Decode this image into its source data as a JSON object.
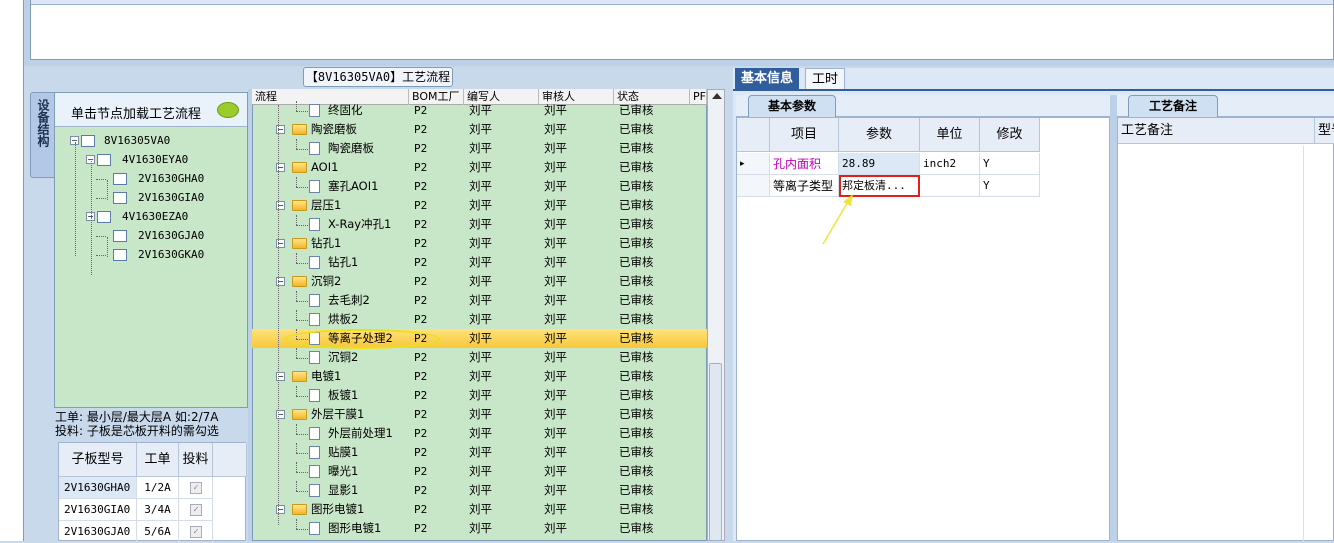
{
  "left_tab": "设备结构",
  "tree_panel": {
    "title": "单击节点加载工艺流程",
    "nodes": [
      {
        "label": "8V16305VA0",
        "level": 0
      },
      {
        "label": "4V1630EYA0",
        "level": 1
      },
      {
        "label": "2V1630GHA0",
        "level": 2
      },
      {
        "label": "2V1630GIA0",
        "level": 2
      },
      {
        "label": "4V1630EZA0",
        "level": 1
      },
      {
        "label": "2V1630GJA0",
        "level": 2
      },
      {
        "label": "2V1630GKA0",
        "level": 2
      }
    ],
    "info_line1": "工单: 最小层/最大层A 如:2/7A",
    "info_line2": "投料: 子板是芯板开料的需勾选"
  },
  "sub_grid": {
    "headers": [
      "子板型号",
      "工单",
      "投料"
    ],
    "rows": [
      {
        "model": "2V1630GHA0",
        "order": "1/2A"
      },
      {
        "model": "2V1630GIA0",
        "order": "3/4A"
      },
      {
        "model": "2V1630GJA0",
        "order": "5/6A"
      }
    ]
  },
  "process": {
    "tab_title": "【8V16305VA0】工艺流程",
    "headers": [
      "流程",
      "BOM工厂",
      "编写人",
      "审核人",
      "状态",
      "PF"
    ],
    "rows": [
      {
        "name": "终固化",
        "type": "doc",
        "factory": "P2",
        "writer": "刘平",
        "reviewer": "刘平",
        "status": "已审核"
      },
      {
        "name": "陶瓷磨板",
        "type": "folder",
        "factory": "P2",
        "writer": "刘平",
        "reviewer": "刘平",
        "status": "已审核"
      },
      {
        "name": "陶瓷磨板",
        "type": "doc",
        "factory": "P2",
        "writer": "刘平",
        "reviewer": "刘平",
        "status": "已审核"
      },
      {
        "name": "AOI1",
        "type": "folder",
        "factory": "P2",
        "writer": "刘平",
        "reviewer": "刘平",
        "status": "已审核"
      },
      {
        "name": "塞孔AOI1",
        "type": "doc",
        "factory": "P2",
        "writer": "刘平",
        "reviewer": "刘平",
        "status": "已审核"
      },
      {
        "name": "层压1",
        "type": "folder",
        "factory": "P2",
        "writer": "刘平",
        "reviewer": "刘平",
        "status": "已审核"
      },
      {
        "name": "X-Ray冲孔1",
        "type": "doc",
        "factory": "P2",
        "writer": "刘平",
        "reviewer": "刘平",
        "status": "已审核"
      },
      {
        "name": "钻孔1",
        "type": "folder",
        "factory": "P2",
        "writer": "刘平",
        "reviewer": "刘平",
        "status": "已审核"
      },
      {
        "name": "钻孔1",
        "type": "doc",
        "factory": "P2",
        "writer": "刘平",
        "reviewer": "刘平",
        "status": "已审核"
      },
      {
        "name": "沉铜2",
        "type": "folder",
        "factory": "P2",
        "writer": "刘平",
        "reviewer": "刘平",
        "status": "已审核"
      },
      {
        "name": "去毛刺2",
        "type": "doc",
        "factory": "P2",
        "writer": "刘平",
        "reviewer": "刘平",
        "status": "已审核"
      },
      {
        "name": "烘板2",
        "type": "doc",
        "factory": "P2",
        "writer": "刘平",
        "reviewer": "刘平",
        "status": "已审核"
      },
      {
        "name": "等离子处理2",
        "type": "doc",
        "factory": "P2",
        "writer": "刘平",
        "reviewer": "刘平",
        "status": "已审核",
        "selected": true
      },
      {
        "name": "沉铜2",
        "type": "doc",
        "factory": "P2",
        "writer": "刘平",
        "reviewer": "刘平",
        "status": "已审核"
      },
      {
        "name": "电镀1",
        "type": "folder",
        "factory": "P2",
        "writer": "刘平",
        "reviewer": "刘平",
        "status": "已审核"
      },
      {
        "name": "板镀1",
        "type": "doc",
        "factory": "P2",
        "writer": "刘平",
        "reviewer": "刘平",
        "status": "已审核"
      },
      {
        "name": "外层干膜1",
        "type": "folder",
        "factory": "P2",
        "writer": "刘平",
        "reviewer": "刘平",
        "status": "已审核"
      },
      {
        "name": "外层前处理1",
        "type": "doc",
        "factory": "P2",
        "writer": "刘平",
        "reviewer": "刘平",
        "status": "已审核"
      },
      {
        "name": "贴膜1",
        "type": "doc",
        "factory": "P2",
        "writer": "刘平",
        "reviewer": "刘平",
        "status": "已审核"
      },
      {
        "name": "曝光1",
        "type": "doc",
        "factory": "P2",
        "writer": "刘平",
        "reviewer": "刘平",
        "status": "已审核"
      },
      {
        "name": "显影1",
        "type": "doc",
        "factory": "P2",
        "writer": "刘平",
        "reviewer": "刘平",
        "status": "已审核"
      },
      {
        "name": "图形电镀1",
        "type": "folder",
        "factory": "P2",
        "writer": "刘平",
        "reviewer": "刘平",
        "status": "已审核"
      },
      {
        "name": "图形电镀1",
        "type": "doc",
        "factory": "P2",
        "writer": "刘平",
        "reviewer": "刘平",
        "status": "已审核"
      }
    ]
  },
  "right_tabs": [
    "基本信息",
    "工时"
  ],
  "params": {
    "subtab": "基本参数",
    "headers": [
      "项目",
      "参数",
      "单位",
      "修改"
    ],
    "rows": [
      {
        "item": "孔内面积",
        "value": "28.89",
        "unit": "inch2",
        "modify": "Y"
      },
      {
        "item": "等离子类型",
        "value": "邦定板清...",
        "unit": "",
        "modify": "Y"
      }
    ]
  },
  "remarks": {
    "subtab": "工艺备注",
    "header": "工艺备注",
    "header2": "型号"
  },
  "colors": {
    "accent": "#2f5d9e",
    "tree_bg": "#c8e6c8",
    "selected": "#f8c73a",
    "highlight": "#e0201a"
  }
}
